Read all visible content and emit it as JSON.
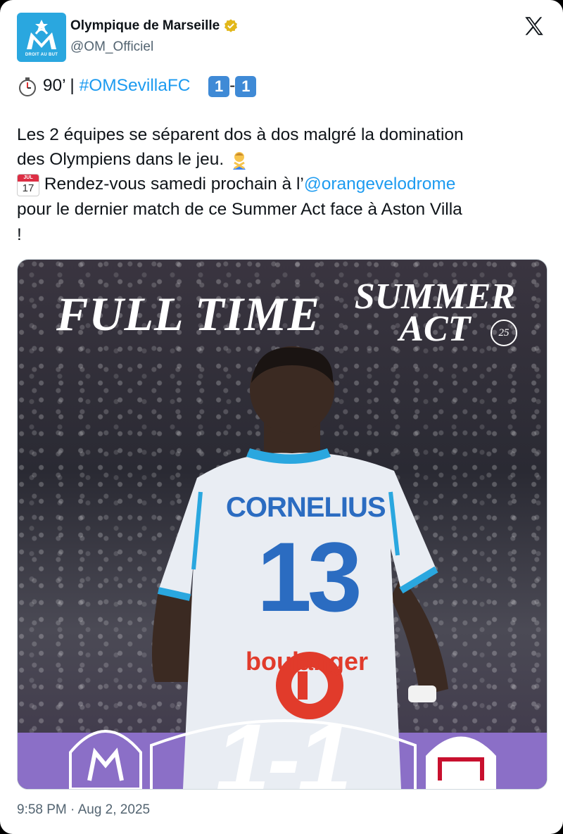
{
  "author": {
    "display_name": "Olympique de Marseille",
    "handle": "@OM_Officiel",
    "avatar_text": "DROIT AU BUT",
    "verified_color": "#e2b719"
  },
  "tweet": {
    "line1_prefix": "90’ | ",
    "hashtag": "#OMSevillaFC",
    "score_home": "1",
    "score_separator": "-",
    "score_away": "1",
    "line2": "Les 2 équipes se séparent dos à dos malgré la domination",
    "line3": "des Olympiens dans le jeu.",
    "line4_prefix": "Rendez-vous samedi prochain à l’",
    "mention": "@orangevelodrome",
    "line5": "pour le dernier match de ce Summer Act face à Aston Villa",
    "line6": "!",
    "calendar_month": "JUL",
    "calendar_day": "17"
  },
  "media": {
    "headline": "FULL TIME",
    "brand_line1": "SUMMER",
    "brand_line2": "ACT",
    "brand_badge": "25",
    "player_name": "CORNELIUS",
    "player_number": "13",
    "sponsor": "boulanger",
    "final_score": "1-1"
  },
  "timestamp": "9:58 PM · Aug 2, 2025",
  "colors": {
    "link": "#1d9bf0",
    "brand_blue": "#2aa7df",
    "score_emoji": "#3f8ad6",
    "band": "#8b6fc7"
  },
  "icons": {
    "stopwatch": "stopwatch-icon",
    "x_logo": "x-logo-icon",
    "person_gesture": "person-gesturing-no-icon",
    "calendar": "calendar-icon"
  }
}
